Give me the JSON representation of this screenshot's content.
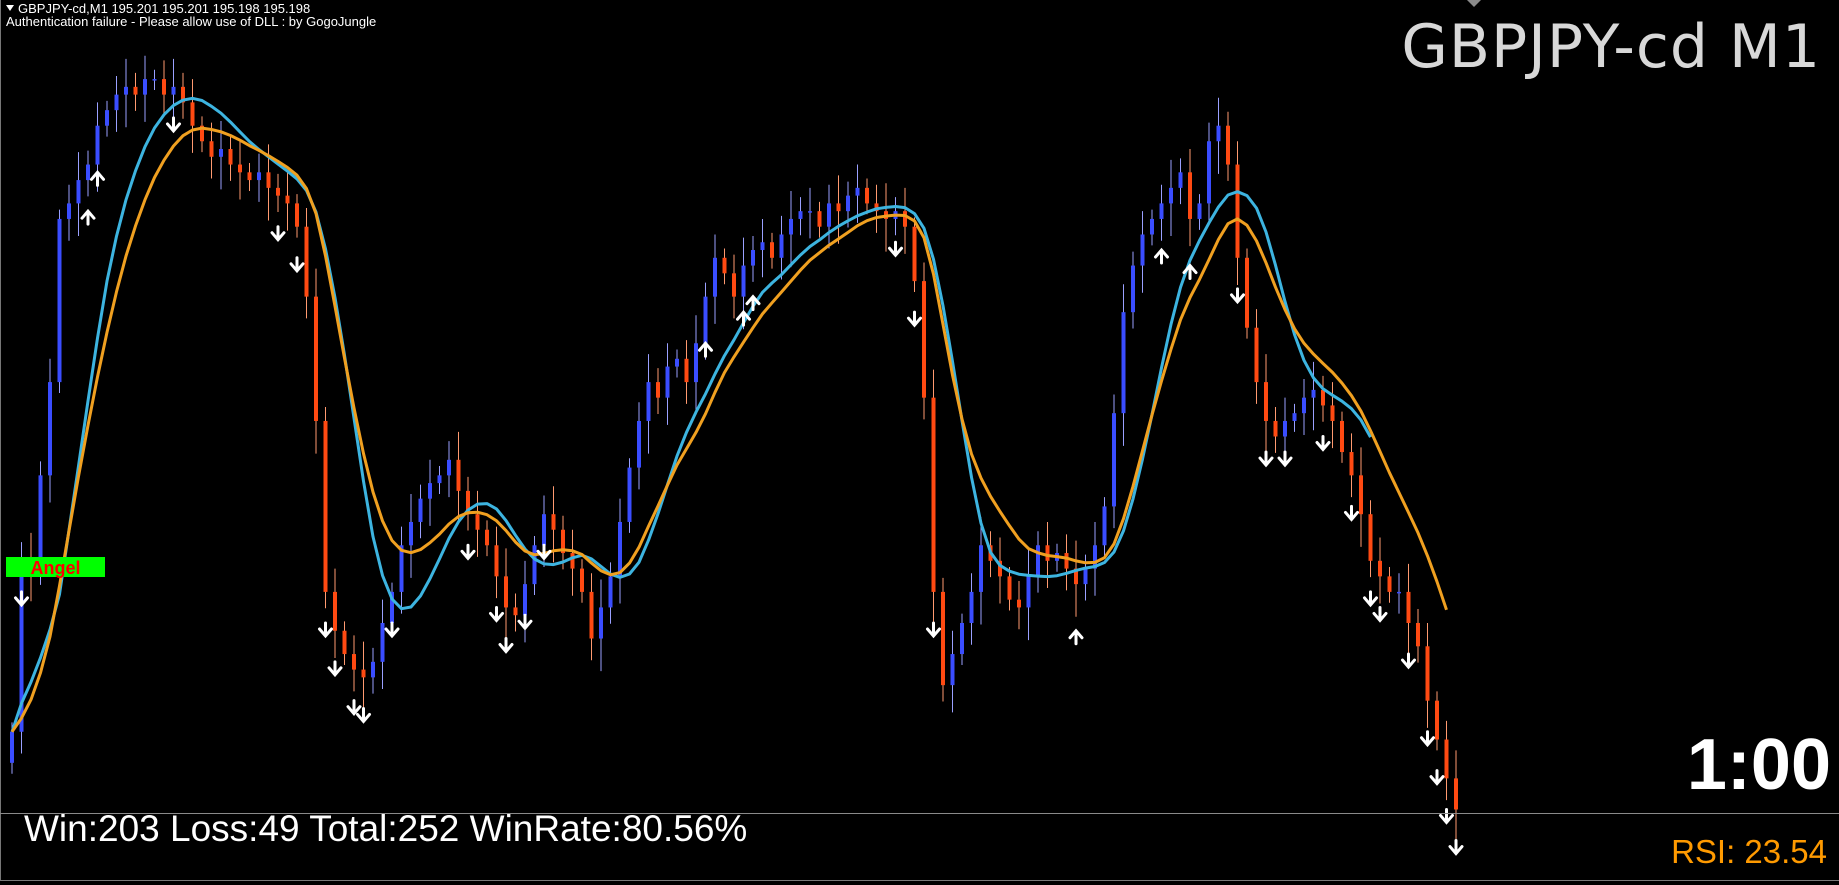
{
  "header": {
    "line1": "GBPJPY-cd,M1  195.201 195.201 195.198 195.198",
    "line2": "Authentication failure - Please allow use of DLL : by GogoJungle"
  },
  "symbol_label": "GBPJPY-cd M1",
  "badge": {
    "label": "Angel",
    "bg_color": "#00ff00",
    "text_color": "#ff0000"
  },
  "timer": "1:00",
  "stats_text": "Win:203 Loss:49 Total:252 WinRate:80.56%",
  "rsi_text": "RSI: 23.54",
  "colors": {
    "background": "#000000",
    "bull_candle": "#3a4dff",
    "bear_candle": "#ff4a12",
    "ma_fast": "#3db4e0",
    "ma_slow": "#f0a020",
    "signal_arrows": "#ffffff",
    "rsi_text": "#ff9a00"
  },
  "chart_data": {
    "type": "line",
    "note_scale": "price in chart units, time in bar index; chart has no printed price or time axis",
    "series": [
      {
        "key": "close",
        "values": [
          12,
          34,
          33,
          45,
          57,
          78,
          80,
          83,
          85,
          90,
          92,
          94,
          95,
          94,
          96,
          96,
          94,
          95,
          93,
          90,
          88,
          86,
          87,
          85,
          84,
          83,
          84,
          82,
          81,
          80,
          77,
          68,
          52,
          30,
          25,
          22,
          20,
          19,
          21,
          26,
          30,
          36,
          39,
          42,
          44,
          45,
          47,
          43,
          40,
          38,
          36,
          32,
          28,
          27,
          31,
          36,
          40,
          38,
          35,
          33,
          30,
          24,
          28,
          32,
          39,
          46,
          52,
          57,
          55,
          59,
          60,
          57,
          62,
          68,
          73,
          71,
          68,
          72,
          74,
          75,
          73,
          76,
          78,
          79,
          79,
          77,
          80,
          79,
          81,
          82,
          80,
          79,
          78,
          79,
          77,
          70,
          55,
          30,
          18,
          22,
          26,
          30,
          36,
          34,
          32,
          29,
          28,
          32,
          36,
          34,
          35,
          33,
          31,
          33,
          36,
          41,
          53,
          66,
          72,
          76,
          78,
          80,
          82,
          84,
          78,
          80,
          88,
          90,
          85,
          73,
          64,
          57,
          52,
          50,
          52,
          53,
          55,
          56,
          54,
          52,
          48,
          45,
          40,
          34,
          32,
          30,
          30,
          26,
          23,
          16,
          11,
          6,
          2
        ]
      },
      {
        "key": "ma_fast",
        "name": ""
      },
      {
        "key": "ma_slow",
        "name": ""
      }
    ],
    "signals": [
      {
        "bar": 1,
        "dir": "down"
      },
      {
        "bar": 8,
        "dir": "up"
      },
      {
        "bar": 9,
        "dir": "up"
      },
      {
        "bar": 17,
        "dir": "down"
      },
      {
        "bar": 28,
        "dir": "down"
      },
      {
        "bar": 30,
        "dir": "down"
      },
      {
        "bar": 33,
        "dir": "down"
      },
      {
        "bar": 34,
        "dir": "down"
      },
      {
        "bar": 36,
        "dir": "down"
      },
      {
        "bar": 37,
        "dir": "down"
      },
      {
        "bar": 40,
        "dir": "down"
      },
      {
        "bar": 48,
        "dir": "down"
      },
      {
        "bar": 51,
        "dir": "down"
      },
      {
        "bar": 52,
        "dir": "down"
      },
      {
        "bar": 54,
        "dir": "down"
      },
      {
        "bar": 56,
        "dir": "down"
      },
      {
        "bar": 73,
        "dir": "up"
      },
      {
        "bar": 77,
        "dir": "up"
      },
      {
        "bar": 78,
        "dir": "up"
      },
      {
        "bar": 93,
        "dir": "down"
      },
      {
        "bar": 95,
        "dir": "down"
      },
      {
        "bar": 97,
        "dir": "down"
      },
      {
        "bar": 112,
        "dir": "up"
      },
      {
        "bar": 121,
        "dir": "up"
      },
      {
        "bar": 124,
        "dir": "up"
      },
      {
        "bar": 129,
        "dir": "down"
      },
      {
        "bar": 132,
        "dir": "down"
      },
      {
        "bar": 134,
        "dir": "down"
      },
      {
        "bar": 138,
        "dir": "down"
      },
      {
        "bar": 141,
        "dir": "down"
      },
      {
        "bar": 143,
        "dir": "down"
      },
      {
        "bar": 144,
        "dir": "down"
      },
      {
        "bar": 147,
        "dir": "down"
      },
      {
        "bar": 149,
        "dir": "down"
      },
      {
        "bar": 150,
        "dir": "down"
      },
      {
        "bar": 151,
        "dir": "down"
      },
      {
        "bar": 152,
        "dir": "down"
      }
    ],
    "grid": false,
    "legend": "none",
    "title": "",
    "xlabel": "",
    "ylabel": ""
  }
}
